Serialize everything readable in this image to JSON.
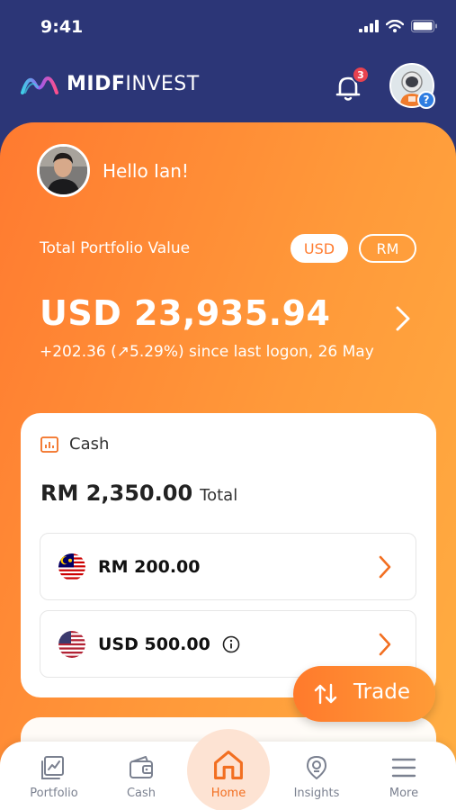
{
  "status_bar": {
    "time": "9:41"
  },
  "header": {
    "logo_bold": "MIDF",
    "logo_light": "INVEST",
    "notification_count": "3",
    "help_symbol": "?"
  },
  "greeting": {
    "text": "Hello Ian!"
  },
  "portfolio": {
    "label": "Total Portfolio Value",
    "currency_options": [
      "USD",
      "RM"
    ],
    "selected_currency": "USD",
    "value": "USD 23,935.94",
    "change": "+202.36 (↗5.29%) since last logon, 26 May"
  },
  "cash": {
    "title": "Cash",
    "total_amount": "RM 2,350.00",
    "total_suffix": "Total",
    "rows": [
      {
        "flag": "malaysia-flag",
        "amount": "RM 200.00"
      },
      {
        "flag": "usa-flag",
        "amount": "USD 500.00"
      }
    ]
  },
  "trade_button": {
    "label": "Trade"
  },
  "nav": {
    "items": [
      {
        "label": "Portfolio",
        "icon": "portfolio-chart-icon"
      },
      {
        "label": "Cash",
        "icon": "wallet-icon"
      },
      {
        "label": "Home",
        "icon": "home-icon"
      },
      {
        "label": "Insights",
        "icon": "insights-icon"
      },
      {
        "label": "More",
        "icon": "menu-icon"
      }
    ],
    "active": "Home"
  },
  "colors": {
    "header_bg": "#2c3677",
    "accent_orange": "#ff7a30",
    "active_nav": "#f26f21",
    "badge_red": "#e8424f"
  }
}
